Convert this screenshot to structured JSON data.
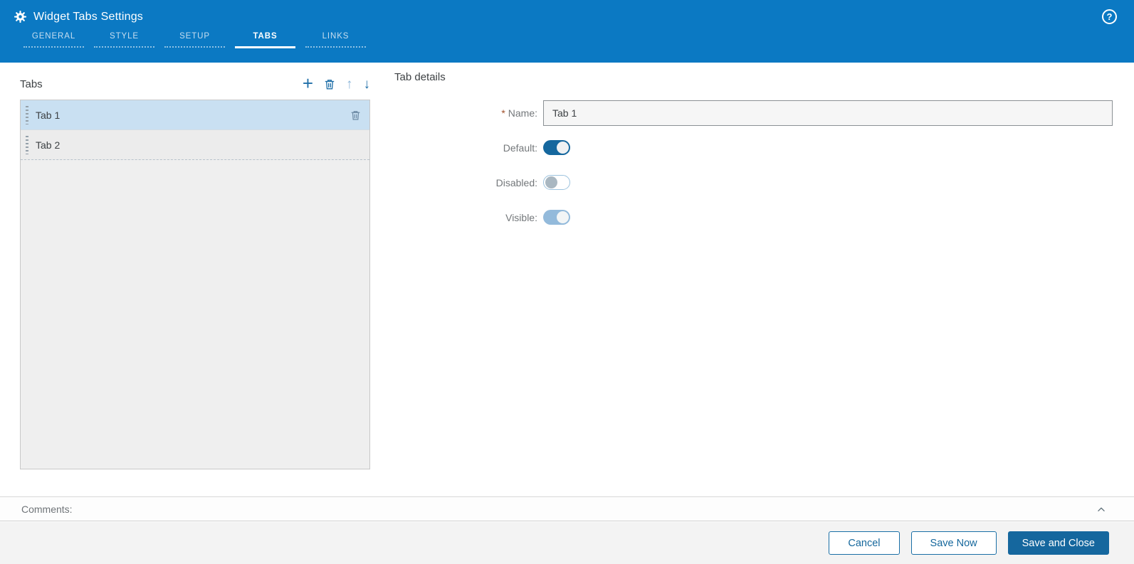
{
  "header": {
    "title": "Widget Tabs Settings",
    "nav_tabs": [
      {
        "label": "GENERAL",
        "active": false
      },
      {
        "label": "STYLE",
        "active": false
      },
      {
        "label": "SETUP",
        "active": false
      },
      {
        "label": "TABS",
        "active": true
      },
      {
        "label": "LINKS",
        "active": false
      }
    ]
  },
  "icons": {
    "plus": "+",
    "arrow_up": "↑",
    "arrow_down": "↓",
    "help": "?"
  },
  "tabs_panel": {
    "heading": "Tabs",
    "items": [
      {
        "label": "Tab 1",
        "selected": true
      },
      {
        "label": "Tab 2",
        "selected": false
      }
    ]
  },
  "details_panel": {
    "heading": "Tab details",
    "name": {
      "required_marker": "*",
      "label": "Name:",
      "value": "Tab 1"
    },
    "toggles": [
      {
        "label": "Default:",
        "state": "on",
        "appearance": "dark"
      },
      {
        "label": "Disabled:",
        "state": "off",
        "appearance": "plain"
      },
      {
        "label": "Visible:",
        "state": "on",
        "appearance": "light"
      }
    ]
  },
  "comments_bar": {
    "label": "Comments:"
  },
  "footer": {
    "cancel_label": "Cancel",
    "save_now_label": "Save Now",
    "save_and_close_label": "Save and Close"
  },
  "colors": {
    "header_bg": "#0b79c3",
    "accent_dark_blue": "#15679e",
    "selected_row_bg": "#c9e0f2",
    "toggle_on_light": "#93badb",
    "required_marker": "#a0502a"
  }
}
